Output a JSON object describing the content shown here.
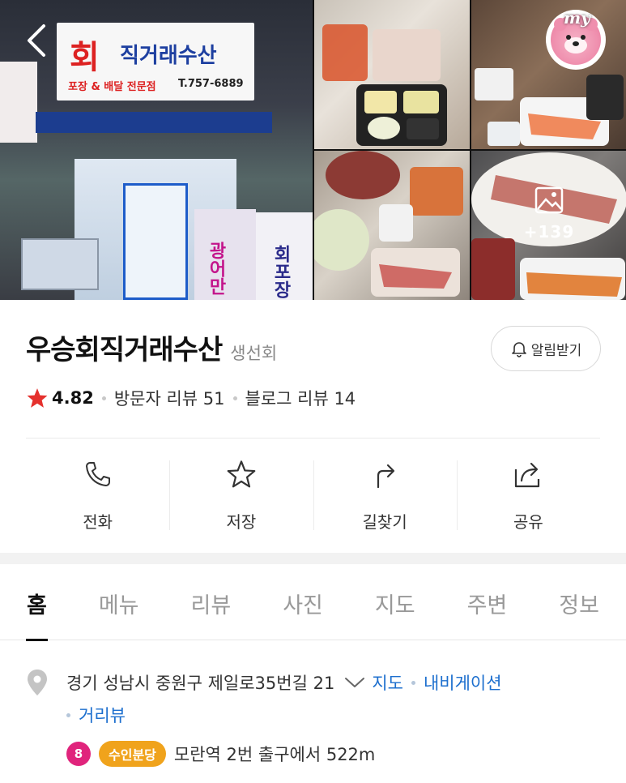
{
  "gallery": {
    "store_sign_hoe": "회",
    "store_sign_name": "직거래수산",
    "store_sign_sub": "포장 & 배달 전문점",
    "store_sign_tel": "T.757-6889",
    "banner_left": "광어만",
    "banner_right": "회포장",
    "more_photos_count": "+139",
    "avatar_label": "my"
  },
  "place": {
    "name": "우승회직거래수산",
    "category": "생선회",
    "alarm_label": "알림받기",
    "rating": "4.82",
    "visitor_reviews": "방문자 리뷰 51",
    "blog_reviews": "블로그 리뷰 14"
  },
  "actions": [
    {
      "label": "전화",
      "icon": "phone-icon"
    },
    {
      "label": "저장",
      "icon": "star-icon"
    },
    {
      "label": "길찾기",
      "icon": "directions-icon"
    },
    {
      "label": "공유",
      "icon": "share-icon"
    }
  ],
  "tabs": [
    {
      "label": "홈",
      "active": true
    },
    {
      "label": "메뉴",
      "active": false
    },
    {
      "label": "리뷰",
      "active": false
    },
    {
      "label": "사진",
      "active": false
    },
    {
      "label": "지도",
      "active": false
    },
    {
      "label": "주변",
      "active": false
    },
    {
      "label": "정보",
      "active": false
    }
  ],
  "address": {
    "text": "경기 성남시 중원구 제일로35번길 21",
    "map_link": "지도",
    "navi_link": "내비게이션",
    "roadview_link": "거리뷰",
    "subway_line_number": "8",
    "subway_line_name": "수인분당",
    "subway_exit": "모란역 2번 출구에서 522m"
  },
  "colors": {
    "star": "#e5312d",
    "link": "#1d6fce",
    "line8": "#e0247c",
    "suin_bundang": "#f0a31c"
  }
}
